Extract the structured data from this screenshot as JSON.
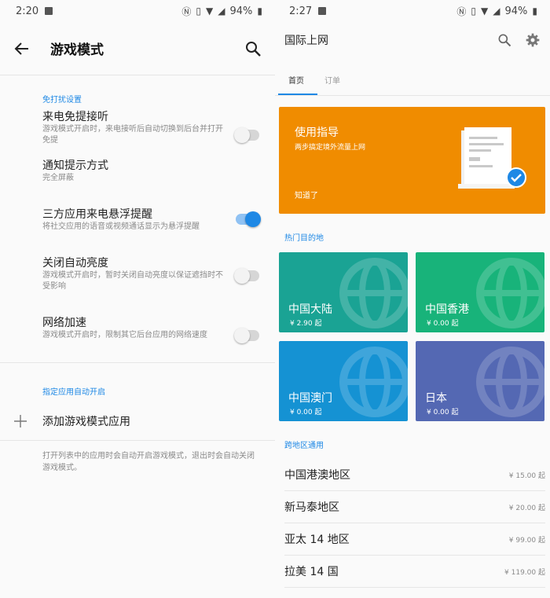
{
  "left": {
    "status": {
      "time": "2:20",
      "battery": "94%"
    },
    "title": "游戏模式",
    "section1": "免打扰设置",
    "settings": [
      {
        "title": "来电免提接听",
        "subtitle": "游戏模式开启时，来电接听后自动切换到后台并打开免提",
        "on": false
      },
      {
        "title": "通知提示方式",
        "subtitle": "完全屏蔽",
        "on": null
      },
      {
        "title": "三方应用来电悬浮提醒",
        "subtitle": "将社交应用的语音或视频通话显示为悬浮提醒",
        "on": true
      },
      {
        "title": "关闭自动亮度",
        "subtitle": "游戏模式开启时，暂时关闭自动亮度以保证遮挡时不受影响",
        "on": false
      },
      {
        "title": "网络加速",
        "subtitle": "游戏模式开启时，限制其它后台应用的网络速度",
        "on": false
      }
    ],
    "section2": "指定应用自动开启",
    "add_label": "添加游戏模式应用",
    "note": "打开列表中的应用时会自动开启游戏模式，退出时会自动关闭游戏模式。"
  },
  "right": {
    "status": {
      "time": "2:27",
      "battery": "94%"
    },
    "title": "国际上网",
    "tabs": [
      "首页",
      "订单"
    ],
    "guide": {
      "title": "使用指导",
      "subtitle": "两步搞定境外流量上网",
      "ok": "知道了"
    },
    "hot_label": "热门目的地",
    "tiles": [
      {
        "name": "中国大陆",
        "price": "¥ 2.90 起",
        "color": "#1aa394"
      },
      {
        "name": "中国香港",
        "price": "¥ 0.00 起",
        "color": "#18b37a"
      },
      {
        "name": "中国澳门",
        "price": "¥ 0.00 起",
        "color": "#1592d3"
      },
      {
        "name": "日本",
        "price": "¥ 0.00 起",
        "color": "#5468b3"
      }
    ],
    "cross_label": "跨地区通用",
    "regions": [
      {
        "name": "中国港澳地区",
        "price": "¥ 15.00 起"
      },
      {
        "name": "新马泰地区",
        "price": "¥ 20.00 起"
      },
      {
        "name": "亚太 14 地区",
        "price": "¥ 99.00 起"
      },
      {
        "name": "拉美 14 国",
        "price": "¥ 119.00 起"
      }
    ]
  }
}
